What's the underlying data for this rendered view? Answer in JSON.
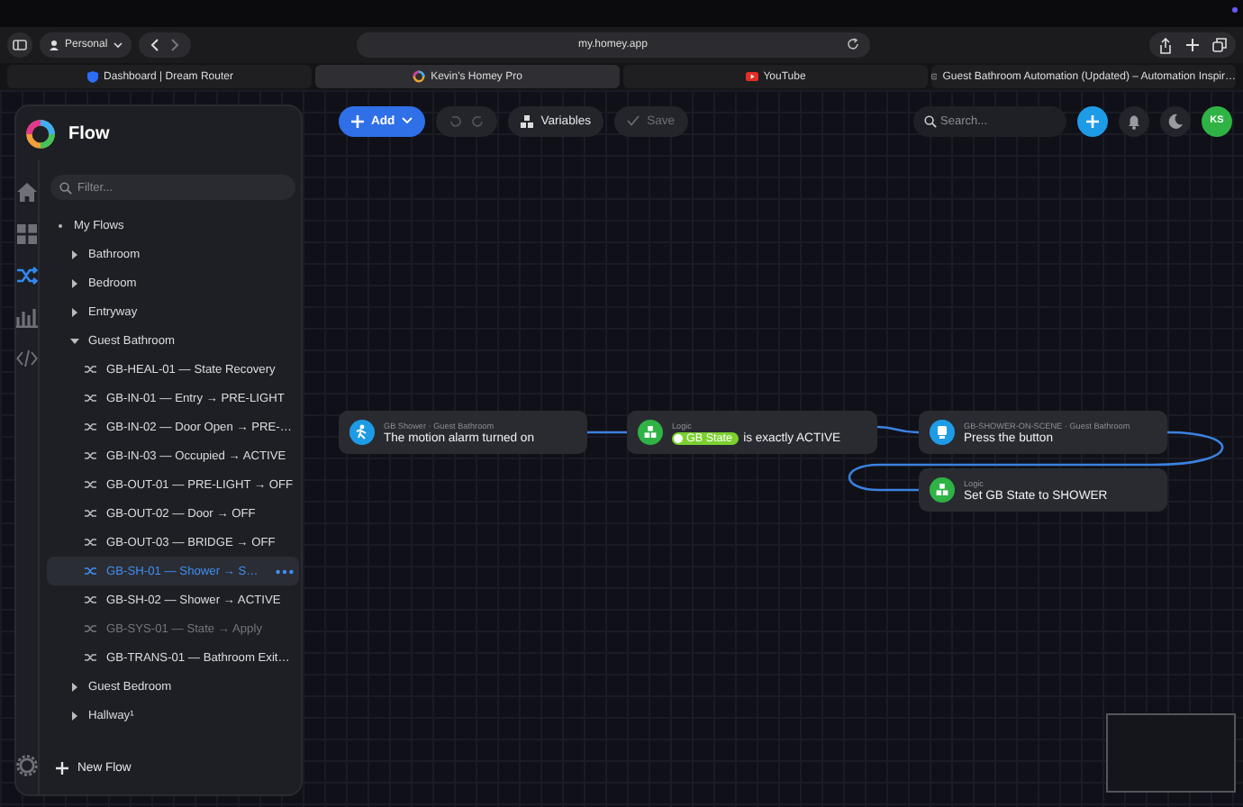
{
  "browser": {
    "profile": "Personal",
    "address": "my.homey.app",
    "tabs": [
      {
        "label": "Dashboard | Dream Router",
        "selected": false
      },
      {
        "label": "Kevin's Homey Pro",
        "selected": true
      },
      {
        "label": "YouTube",
        "selected": false
      },
      {
        "label": "Guest Bathroom Automation (Updated) – Automation Inspir…",
        "selected": false
      }
    ]
  },
  "sidebar": {
    "title": "Flow",
    "nav": [
      {
        "selected": false
      },
      {
        "selected": false
      },
      {
        "selected": true
      },
      {
        "selected": false
      },
      {
        "selected": false
      }
    ],
    "filter": {
      "placeholder": "Filter..."
    },
    "tree": [
      {
        "label": "My Flows",
        "expanded": true,
        "children": [
          {
            "label": "Bathroom",
            "expanded": false
          },
          {
            "label": "Bedroom",
            "expanded": false
          },
          {
            "label": "Entryway",
            "expanded": false
          },
          {
            "label": "Guest Bathroom",
            "expanded": true,
            "children": [
              {
                "label": "GB-HEAL-01 — State Recovery",
                "selected": false,
                "disabled": false
              },
              {
                "label": "GB-IN-01 — Entry → PRE-LIGHT",
                "selected": false,
                "disabled": false
              },
              {
                "label": "GB-IN-02 — Door Open → PRE-…",
                "selected": false,
                "disabled": false
              },
              {
                "label": "GB-IN-03 — Occupied → ACTIVE",
                "selected": false,
                "disabled": false
              },
              {
                "label": "GB-OUT-01 — PRE-LIGHT → OFF",
                "selected": false,
                "disabled": false
              },
              {
                "label": "GB-OUT-02 — Door → OFF",
                "selected": false,
                "disabled": false
              },
              {
                "label": "GB-OUT-03 — BRIDGE → OFF",
                "selected": false,
                "disabled": false
              },
              {
                "label": "GB-SH-01 — Shower → S…",
                "selected": true,
                "disabled": false
              },
              {
                "label": "GB-SH-02 — Shower → ACTIVE",
                "selected": false,
                "disabled": false
              },
              {
                "label": "GB-SYS-01 — State → Apply",
                "selected": false,
                "disabled": true
              },
              {
                "label": "GB-TRANS-01 — Bathroom Exit…",
                "selected": false,
                "disabled": false
              }
            ]
          },
          {
            "label": "Guest Bedroom",
            "expanded": false
          },
          {
            "label": "Hallway¹",
            "expanded": false
          }
        ]
      }
    ],
    "new_flow": "New Flow"
  },
  "toolbar": {
    "add": "Add",
    "variables": "Variables",
    "save": {
      "label": "Save",
      "disabled": true
    },
    "search": {
      "placeholder": "Search..."
    },
    "avatar": "KS"
  },
  "nodes": [
    {
      "kind": "motion",
      "color": "#1e9be6",
      "source": "GB Shower · Guest Bathroom",
      "text": "The motion alarm turned on"
    },
    {
      "kind": "logic",
      "color": "#2eb344",
      "source": "Logic",
      "tag": "GB State",
      "text": "is exactly ACTIVE"
    },
    {
      "kind": "button",
      "color": "#1e9be6",
      "source": "GB-SHOWER-ON-SCENE · Guest Bathroom",
      "text": "Press the button"
    },
    {
      "kind": "logic",
      "color": "#2eb344",
      "source": "Logic",
      "text": "Set GB State to SHOWER"
    }
  ]
}
